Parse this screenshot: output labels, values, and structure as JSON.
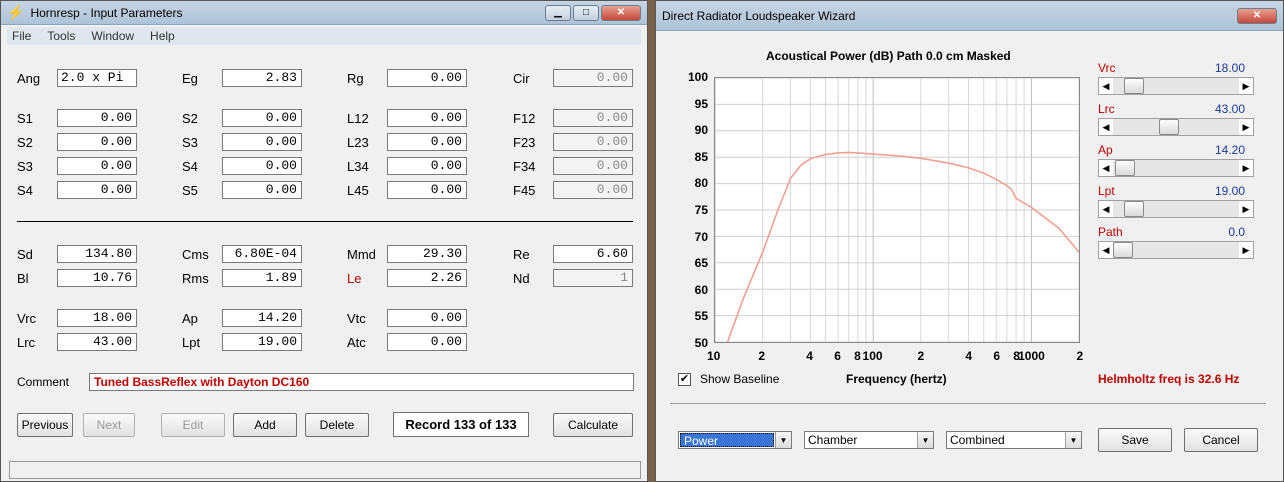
{
  "input_window": {
    "title": "Hornresp - Input Parameters",
    "menu": [
      "File",
      "Tools",
      "Window",
      "Help"
    ],
    "fields": {
      "ang": {
        "label": "Ang",
        "value": "2.0 x Pi"
      },
      "eg": {
        "label": "Eg",
        "value": "2.83"
      },
      "rg": {
        "label": "Rg",
        "value": "0.00"
      },
      "cir": {
        "label": "Cir",
        "value": "0.00"
      },
      "s1": {
        "label": "S1",
        "value": "0.00"
      },
      "s2a": {
        "label": "S2",
        "value": "0.00"
      },
      "l12": {
        "label": "L12",
        "value": "0.00"
      },
      "f12": {
        "label": "F12",
        "value": "0.00"
      },
      "s2": {
        "label": "S2",
        "value": "0.00"
      },
      "s3a": {
        "label": "S3",
        "value": "0.00"
      },
      "l23": {
        "label": "L23",
        "value": "0.00"
      },
      "f23": {
        "label": "F23",
        "value": "0.00"
      },
      "s3": {
        "label": "S3",
        "value": "0.00"
      },
      "s4a": {
        "label": "S4",
        "value": "0.00"
      },
      "l34": {
        "label": "L34",
        "value": "0.00"
      },
      "f34": {
        "label": "F34",
        "value": "0.00"
      },
      "s4": {
        "label": "S4",
        "value": "0.00"
      },
      "s5": {
        "label": "S5",
        "value": "0.00"
      },
      "l45": {
        "label": "L45",
        "value": "0.00"
      },
      "f45": {
        "label": "F45",
        "value": "0.00"
      },
      "sd": {
        "label": "Sd",
        "value": "134.80"
      },
      "cms": {
        "label": "Cms",
        "value": "6.80E-04"
      },
      "mmd": {
        "label": "Mmd",
        "value": "29.30"
      },
      "re": {
        "label": "Re",
        "value": "6.60"
      },
      "bl": {
        "label": "Bl",
        "value": "10.76"
      },
      "rms": {
        "label": "Rms",
        "value": "1.89"
      },
      "le": {
        "label": "Le",
        "value": "2.26"
      },
      "nd": {
        "label": "Nd",
        "value": "1"
      },
      "vrc": {
        "label": "Vrc",
        "value": "18.00"
      },
      "ap": {
        "label": "Ap",
        "value": "14.20"
      },
      "vtc": {
        "label": "Vtc",
        "value": "0.00"
      },
      "lrc": {
        "label": "Lrc",
        "value": "43.00"
      },
      "lpt": {
        "label": "Lpt",
        "value": "19.00"
      },
      "atc": {
        "label": "Atc",
        "value": "0.00"
      }
    },
    "comment_label": "Comment",
    "comment_value": "Tuned BassReflex with Dayton DC160",
    "buttons": {
      "previous": "Previous",
      "next": "Next",
      "edit": "Edit",
      "add": "Add",
      "delete": "Delete",
      "calculate": "Calculate"
    },
    "record": "Record 133 of 133"
  },
  "wizard_window": {
    "title": "Direct Radiator Loudspeaker Wizard",
    "chart_heading": "Acoustical Power (dB)   Path 0.0 cm   Masked",
    "x_axis_label": "Frequency (hertz)",
    "show_baseline_label": "Show Baseline",
    "show_baseline_checked": true,
    "helmholtz": "Helmholtz freq is 32.6 Hz",
    "sliders": [
      {
        "label": "Vrc",
        "value": "18.00",
        "position": 0.1
      },
      {
        "label": "Lrc",
        "value": "43.00",
        "position": 0.43
      },
      {
        "label": "Ap",
        "value": "14.20",
        "position": 0.02
      },
      {
        "label": "Lpt",
        "value": "19.00",
        "position": 0.1
      },
      {
        "label": "Path",
        "value": "0.0",
        "position": 0.0
      }
    ],
    "combos": {
      "mode": "Power",
      "chamber": "Chamber",
      "combined": "Combined"
    },
    "buttons": {
      "save": "Save",
      "cancel": "Cancel"
    }
  },
  "chart_data": {
    "type": "line",
    "title": "Acoustical Power (dB)   Path 0.0 cm   Masked",
    "xlabel": "Frequency (hertz)",
    "ylabel": "",
    "x_scale": "log",
    "xlim": [
      10,
      200
    ],
    "ylim": [
      50,
      100
    ],
    "y_ticks": [
      100,
      95,
      90,
      85,
      80,
      75,
      70,
      65,
      60,
      55,
      50
    ],
    "x_tick_labels": [
      "10",
      "2",
      "4",
      "6",
      "8",
      "100",
      "2",
      "4",
      "6",
      "8",
      "1000",
      "2"
    ],
    "grid": true,
    "series": [
      {
        "color": "#f0a090",
        "x": [
          12,
          15,
          20,
          25,
          30,
          35,
          40,
          50,
          60,
          70,
          80,
          100,
          150,
          200,
          300,
          400,
          500,
          600,
          700,
          750,
          800,
          1000,
          1500,
          2000
        ],
        "y": [
          50,
          58,
          67,
          75,
          81,
          83.5,
          84.7,
          85.5,
          85.8,
          85.9,
          85.8,
          85.6,
          85.2,
          84.8,
          83.9,
          83,
          82,
          80.8,
          79.6,
          78.9,
          77.2,
          75.5,
          71.5,
          67
        ]
      }
    ]
  }
}
